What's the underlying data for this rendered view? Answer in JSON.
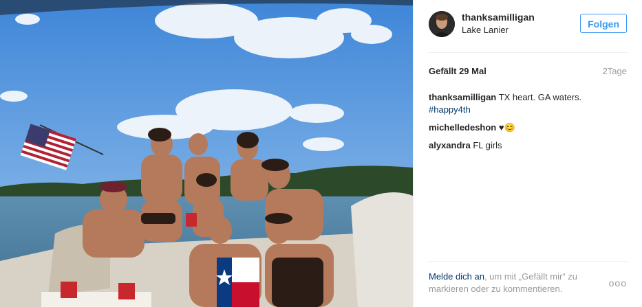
{
  "post": {
    "username": "thanksamilligan",
    "location": "Lake Lanier",
    "follow_label": "Folgen",
    "likes_label": "Gefällt 29 Mal",
    "time_label": "2Tage"
  },
  "comments": [
    {
      "user": "thanksamilligan",
      "text": "TX heart. GA waters.",
      "hashtag": "#happy4th"
    },
    {
      "user": "michelledeshon",
      "text": "♥😊"
    },
    {
      "user": "alyxandra",
      "text": "FL girls"
    }
  ],
  "footer": {
    "login_link": "Melde dich an",
    "login_rest": ", um mit „Gefällt mir“ zu markieren oder zu kommentieren.",
    "more_label": "ooo"
  },
  "colors": {
    "link_blue": "#3897f0",
    "hashtag_blue": "#003569"
  }
}
